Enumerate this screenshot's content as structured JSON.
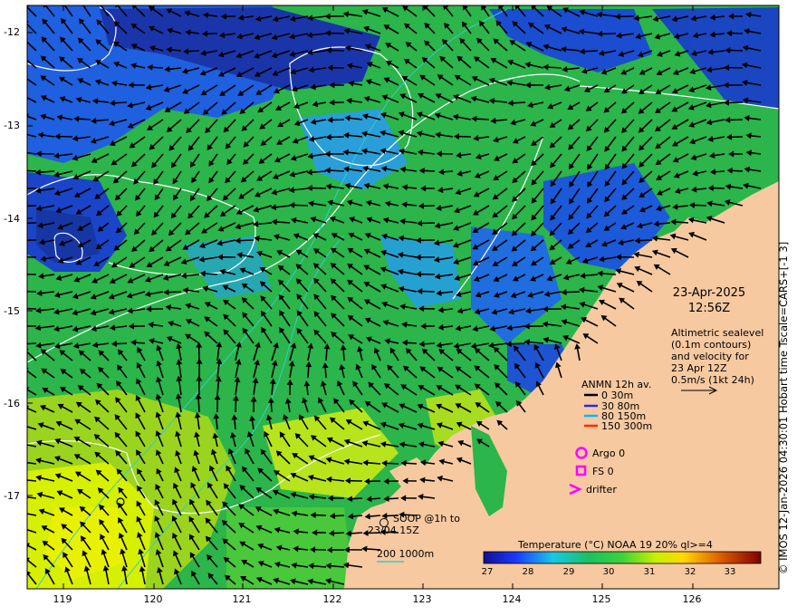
{
  "map": {
    "date_line1": "23-Apr-2025",
    "date_line2": "12:56Z",
    "altimetry_note": [
      "Altimetric sealevel",
      "(0.1m contours)",
      "and velocity for",
      "23 Apr 12Z",
      "0.5m/s (1kt 24h)"
    ],
    "lon_ticks": [
      "119",
      "120",
      "121",
      "122",
      "123",
      "124",
      "125",
      "126"
    ],
    "lat_ticks": [
      "-12",
      "-13",
      "-14",
      "-15",
      "-16",
      "-17"
    ],
    "side_caption": "© IMOS 12-Jan-2026 04:30:01 Hobart time Tscale=CARS+[-1 3]",
    "anmn": {
      "title": "ANMN 12h av.",
      "items": [
        {
          "label": "0 30m",
          "color": "#000000"
        },
        {
          "label": "30 80m",
          "color": "#2a2ae0"
        },
        {
          "label": "80 150m",
          "color": "#00b7ff"
        },
        {
          "label": "150 300m",
          "color": "#ff2a00"
        }
      ]
    },
    "argo_label": "Argo 0",
    "fs_label": "FS 0",
    "drifter_label": "drifter",
    "soop_line1": "SOOP @1h to",
    "soop_line2": "23/04 15Z",
    "bathy_label": "200  1000m",
    "colorbar": {
      "title": "Temperature (°C) NOAA 19 20% ql>=4",
      "ticks": [
        "27",
        "28",
        "29",
        "30",
        "31",
        "32",
        "33"
      ]
    },
    "colors": {
      "land": "#f7c9a0",
      "marker_magenta": "#ff00ff",
      "contour": "#ffffff",
      "isobath": "#33cccc"
    }
  }
}
